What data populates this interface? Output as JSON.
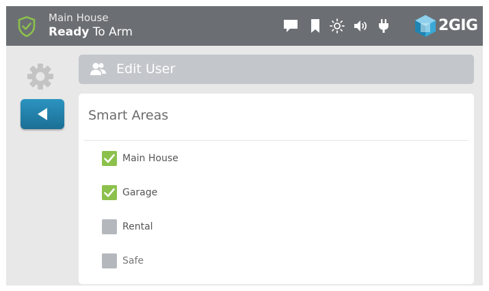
{
  "status_bar": {
    "area_name": "Main House",
    "status_bold": "Ready",
    "status_rest": " To Arm",
    "icons": [
      "message-icon",
      "bookmark-icon",
      "brightness-icon",
      "volume-icon",
      "power-plug-icon"
    ],
    "brand": "2GIG"
  },
  "header": {
    "title": "Edit User",
    "icon": "user-icon"
  },
  "panel": {
    "title": "Smart Areas",
    "areas": [
      {
        "label": "Main House",
        "checked": true
      },
      {
        "label": "Garage",
        "checked": true
      },
      {
        "label": "Rental",
        "checked": false
      },
      {
        "label": "Safe",
        "checked": false
      }
    ]
  },
  "colors": {
    "status_bar": "#6b6f73",
    "background": "#e8e8e8",
    "accent_blue": "#1f7fab",
    "check_green": "#8cc14c",
    "check_gray": "#b4b8bd",
    "shield_green": "#8cc14c"
  }
}
